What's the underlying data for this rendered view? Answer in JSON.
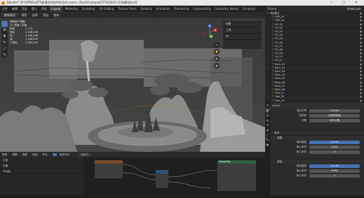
{
  "app": {
    "title": "Blender* [D:\\UPRG\\LUTT\\新建文件夹\\file\\3ad scene_v5a\\ctrl\\sample\\2776\\2022-11\\场景\\blend]",
    "accent": "#4772b3",
    "logo_color": "#e87d0d"
  },
  "menu": {
    "items": [
      "文件",
      "编辑",
      "渲染",
      "窗口",
      "帮助",
      "Layout",
      "Modeling",
      "Sculpting",
      "UV Editing",
      "Texture Paint",
      "Shading",
      "Animation",
      "Rendering",
      "Compositing",
      "Geometry Nodes",
      "Scripting"
    ],
    "active_index": 5
  },
  "viewport": {
    "header_left": "物体模式",
    "header_items": [
      "视图",
      "选择",
      "添加",
      "物体"
    ],
    "stats": [
      {
        "k": "透视用户视图",
        "v": ""
      },
      {
        "k": "(1) 场景 | 平面",
        "v": ""
      },
      {
        "k": "物体",
        "v": "1 / 34"
      },
      {
        "k": "顶点",
        "v": "2,166,228"
      },
      {
        "k": "边",
        "v": "2,996,098"
      },
      {
        "k": "面",
        "v": "1,438,872"
      },
      {
        "k": "三角形",
        "v": "2,469,019"
      }
    ],
    "npanel_tabs": [
      "视图",
      "工具",
      "项"
    ],
    "gizmo_labels": {
      "x": "X",
      "y": "Y",
      "z": "Z"
    }
  },
  "node_editor": {
    "header_items": [
      "物体",
      "视图",
      "选择",
      "添加",
      "节点",
      "使用节点"
    ],
    "slot": "Slot 1",
    "left_rows": [
      "平面",
      "光源",
      "节点组"
    ],
    "node_title": "Group Box"
  },
  "outliner": {
    "title": "Scene",
    "view_layer": "ViewLayer",
    "rows": [
      "场景集合",
      "GRP_02",
      "GRP_03",
      "CH_01",
      "CH_02",
      "CH_03",
      "CH_04",
      "CH_05",
      "CH_06",
      "CH_07",
      "CH_08",
      "CH_09",
      "CH_10",
      "CH_11",
      "Rock_01",
      "Rock_02",
      "Rock_03",
      "Rock_04",
      "Rock_05",
      "Rock_06",
      "Rock_07",
      "Rock_08",
      "Tree_01",
      "Tree_02",
      "Tree_03"
    ]
  },
  "properties": {
    "header": "Scene",
    "rows": [
      {
        "label": "渲染引擎",
        "value": "Cycles"
      },
      {
        "label": "特性集",
        "value": "支持的特性"
      },
      {
        "label": "设备",
        "value": "GPU计算"
      }
    ],
    "section1": "采样",
    "section1_sub": "视图",
    "section1_rows": [
      {
        "label": "噪波阈值",
        "value": "0.1000",
        "blue": true
      },
      {
        "label": "最大采样",
        "value": "1024"
      },
      {
        "label": "最小采样",
        "value": "0"
      }
    ],
    "section2": "渲染",
    "section2_rows": [
      {
        "label": "噪波阈值",
        "value": "0.0100",
        "blue": true
      },
      {
        "label": "最大采样",
        "value": "4096"
      },
      {
        "label": "最小采样",
        "value": "0"
      }
    ]
  }
}
